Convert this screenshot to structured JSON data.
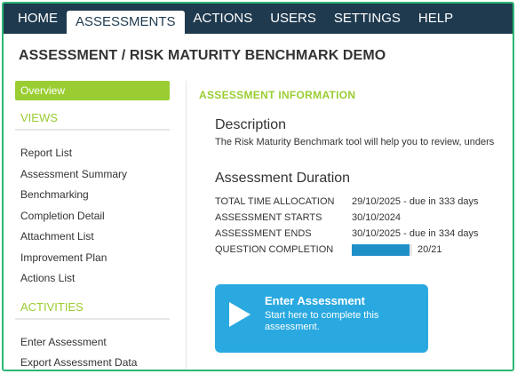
{
  "nav": {
    "items": [
      "HOME",
      "ASSESSMENTS",
      "ACTIONS",
      "USERS",
      "SETTINGS",
      "HELP"
    ],
    "active": "ASSESSMENTS"
  },
  "page_title": "ASSESSMENT / RISK MATURITY BENCHMARK DEMO",
  "sidebar": {
    "overview": "Overview",
    "views_heading": "VIEWS",
    "views": [
      "Report List",
      "Assessment Summary",
      "Benchmarking",
      "Completion Detail",
      "Attachment List",
      "Improvement Plan",
      "Actions List"
    ],
    "activities_heading": "ACTIVITIES",
    "activities": [
      "Enter Assessment",
      "Export Assessment Data"
    ]
  },
  "main": {
    "section_title": "ASSESSMENT INFORMATION",
    "description_heading": "Description",
    "description_text": "The Risk Maturity Benchmark tool will help you to review, unders",
    "duration_heading": "Assessment Duration",
    "rows": [
      {
        "label": "TOTAL TIME ALLOCATION",
        "value": "29/10/2025 - due in 333 days"
      },
      {
        "label": "ASSESSMENT STARTS",
        "value": "30/10/2024"
      },
      {
        "label": "ASSESSMENT ENDS",
        "value": "30/10/2025 - due in 334 days"
      }
    ],
    "completion_label": "QUESTION COMPLETION",
    "completion_text": "20/21",
    "completion_fraction": 0.952,
    "enter_button": {
      "title": "Enter Assessment",
      "subtitle": "Start here to complete this assessment."
    }
  },
  "colors": {
    "nav_bg": "#1f3a4f",
    "accent_green": "#9acd32",
    "button_blue": "#2aa9e0",
    "progress_blue": "#1f8fc8",
    "frame_border": "#2bb673"
  }
}
